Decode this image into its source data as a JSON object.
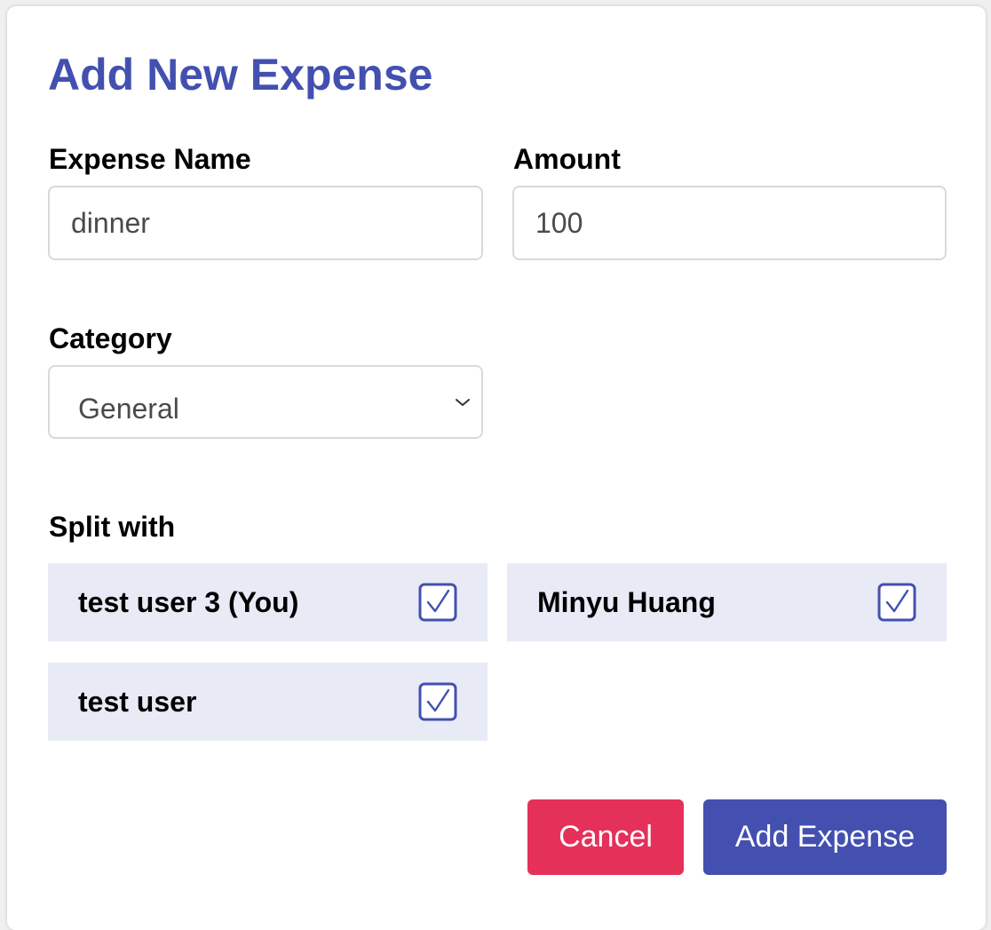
{
  "modal": {
    "title": "Add New Expense"
  },
  "form": {
    "expense_name": {
      "label": "Expense Name",
      "value": "dinner"
    },
    "amount": {
      "label": "Amount",
      "value": "100"
    },
    "category": {
      "label": "Category",
      "selected": "General"
    },
    "split": {
      "label": "Split with",
      "members": [
        {
          "name": "test user 3 (You)",
          "checked": true
        },
        {
          "name": "Minyu Huang",
          "checked": true
        },
        {
          "name": "test user",
          "checked": true
        }
      ]
    }
  },
  "actions": {
    "cancel_label": "Cancel",
    "submit_label": "Add Expense"
  },
  "colors": {
    "accent": "#4350b0",
    "danger": "#e5305a",
    "member_bg": "#e8eaf6"
  },
  "icons": {
    "dropdown": "chevron-down-icon",
    "checkbox": "checkbox-checked-icon"
  }
}
